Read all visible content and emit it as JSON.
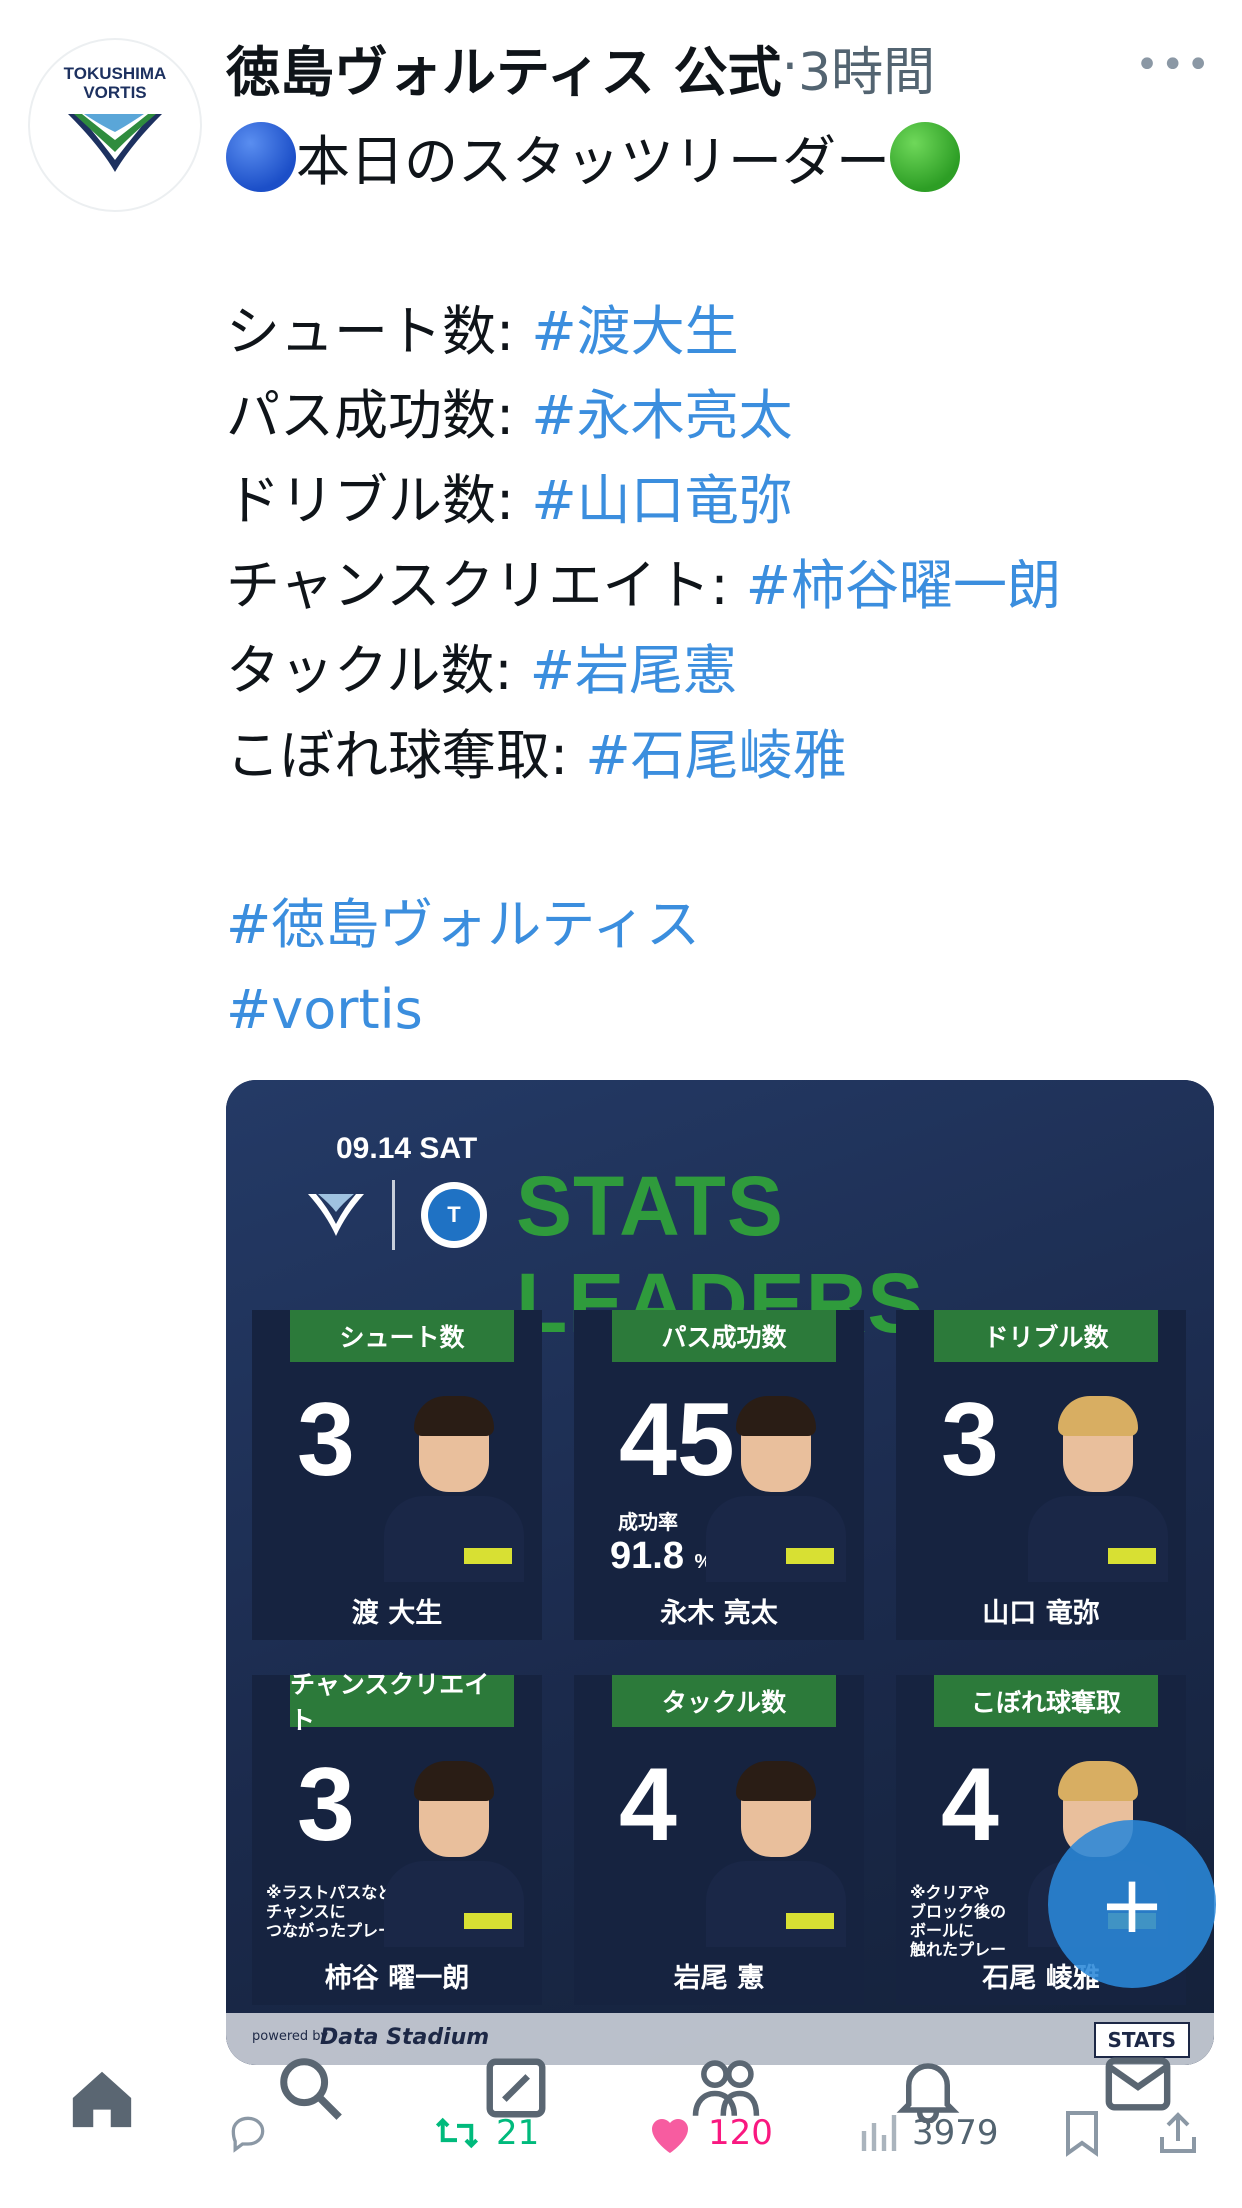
{
  "tweet": {
    "author": "徳島ヴォルティス 公式",
    "separator": "·",
    "time": "3時間",
    "more": "•••",
    "avatar_text_1": "TOKUSHIMA",
    "avatar_text_2": "VORTIS",
    "headline": "本日のスタッツリーダー",
    "stats_lines": [
      {
        "label": "シュート数: ",
        "tag": "#渡大生"
      },
      {
        "label": "パス成功数: ",
        "tag": "#永木亮太"
      },
      {
        "label": "ドリブル数: ",
        "tag": "#山口竜弥"
      },
      {
        "label": "チャンスクリエイト: ",
        "tag": "#柿谷曜一朗"
      },
      {
        "label": "タックル数: ",
        "tag": "#岩尾憲"
      },
      {
        "label": "こぼれ球奪取: ",
        "tag": "#石尾崚雅"
      }
    ],
    "hashtags": [
      "#徳島ヴォルティス",
      "#vortis"
    ]
  },
  "card": {
    "date": "09.14 SAT",
    "title": "STATS LEADERS",
    "cells": [
      {
        "label": "シュート数",
        "value": "3",
        "name": "渡 大生",
        "note": ""
      },
      {
        "label": "パス成功数",
        "value": "45",
        "name": "永木 亮太",
        "rate_label": "成功率",
        "rate_value": "91.8",
        "rate_unit": "%"
      },
      {
        "label": "ドリブル数",
        "value": "3",
        "name": "山口 竜弥",
        "note": ""
      },
      {
        "label": "チャンスクリエイト",
        "value": "3",
        "name": "柿谷 曜一朗",
        "note": "※ラストパスなど\nチャンスに\nつながったプレー"
      },
      {
        "label": "タックル数",
        "value": "4",
        "name": "岩尾 憲",
        "note": ""
      },
      {
        "label": "こぼれ球奪取",
        "value": "4",
        "name": "石尾 崚雅",
        "note": "※クリアや\nブロック後の\nボールに\n触れたプレー"
      }
    ],
    "powered_by": "powered by",
    "data_stadium": "Data Stadium",
    "stats_badge": "STATS"
  },
  "actions": {
    "retweets": "21",
    "likes": "120",
    "views": "3979"
  },
  "colors": {
    "link": "#3b8ede",
    "retweet": "#00ba7c",
    "like": "#f91880",
    "fab": "#2a88d8"
  }
}
